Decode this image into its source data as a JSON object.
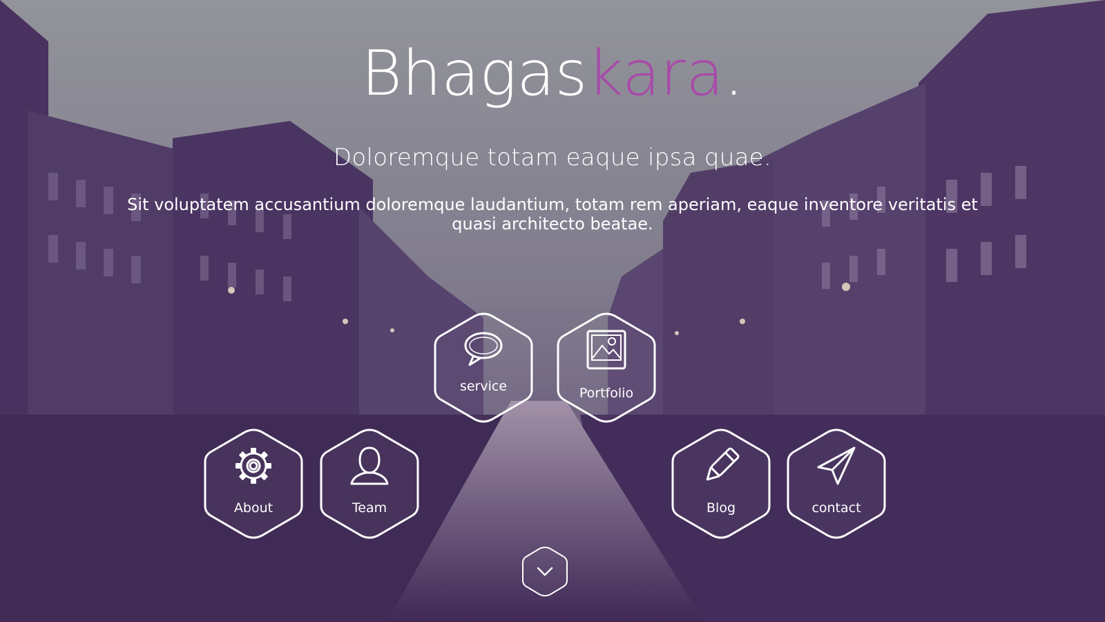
{
  "hero": {
    "title_part1": "Bhagas",
    "title_part2": "kara",
    "title_dot": ".",
    "subtitle": "Doloremque totam eaque ipsa quae.",
    "description": "Sit voluptatem accusantium doloremque laudantium, totam rem aperiam, eaque inventore veritatis et quasi architecto beatae."
  },
  "nav": {
    "service": {
      "label": "service",
      "icon": "speech-bubble-icon"
    },
    "portfolio": {
      "label": "Portfolio",
      "icon": "image-icon"
    },
    "about": {
      "label": "About",
      "icon": "gear-icon"
    },
    "team": {
      "label": "Team",
      "icon": "user-icon"
    },
    "blog": {
      "label": "Blog",
      "icon": "pencil-icon"
    },
    "contact": {
      "label": "contact",
      "icon": "paper-plane-icon"
    }
  },
  "scroll": {
    "icon": "chevron-down-icon"
  },
  "colors": {
    "accent": "#a84aa8",
    "text": "#ffffff"
  }
}
